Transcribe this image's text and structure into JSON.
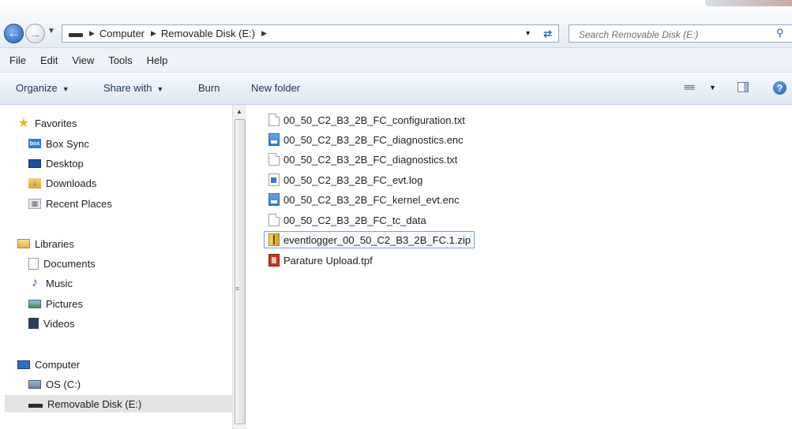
{
  "address_bar": {
    "breadcrumbs": [
      "Computer",
      "Removable Disk (E:)"
    ]
  },
  "search": {
    "placeholder": "Search Removable Disk (E:)"
  },
  "menu": [
    "File",
    "Edit",
    "View",
    "Tools",
    "Help"
  ],
  "toolbar": {
    "organize": "Organize",
    "share_with": "Share with",
    "burn": "Burn",
    "new_folder": "New folder"
  },
  "nav": {
    "favorites": {
      "label": "Favorites",
      "items": [
        "Box Sync",
        "Desktop",
        "Downloads",
        "Recent Places"
      ]
    },
    "libraries": {
      "label": "Libraries",
      "items": [
        "Documents",
        "Music",
        "Pictures",
        "Videos"
      ]
    },
    "computer": {
      "label": "Computer",
      "items": [
        "OS (C:)",
        "Removable Disk (E:)"
      ],
      "selected": "Removable Disk (E:)"
    }
  },
  "files": [
    {
      "name": "00_50_C2_B3_2B_FC_configuration.txt",
      "icon": "text-file-icon"
    },
    {
      "name": "00_50_C2_B3_2B_FC_diagnostics.enc",
      "icon": "enc-file-icon"
    },
    {
      "name": "00_50_C2_B3_2B_FC_diagnostics.txt",
      "icon": "text-file-icon"
    },
    {
      "name": "00_50_C2_B3_2B_FC_evt.log",
      "icon": "log-file-icon"
    },
    {
      "name": "00_50_C2_B3_2B_FC_kernel_evt.enc",
      "icon": "enc-file-icon"
    },
    {
      "name": "00_50_C2_B3_2B_FC_tc_data",
      "icon": "blank-file-icon"
    },
    {
      "name": "eventlogger_00_50_C2_B3_2B_FC.1.zip",
      "icon": "zip-file-icon",
      "selected": true
    },
    {
      "name": "Parature Upload.tpf",
      "icon": "tpf-file-icon"
    }
  ]
}
